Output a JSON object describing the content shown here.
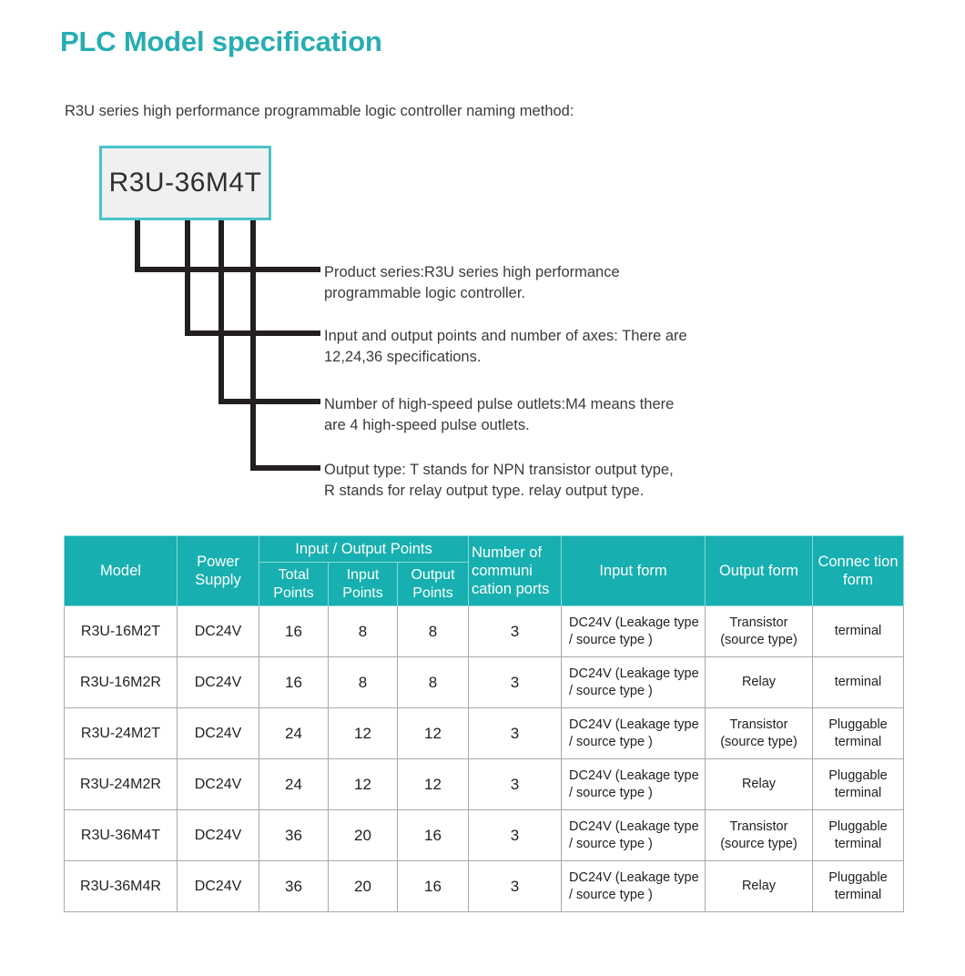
{
  "page": {
    "title": "PLC Model specification",
    "intro": "R3U series high performance programmable logic controller naming method:",
    "accent_color": "#27ADB2",
    "table_header_color": "#17AFAF",
    "box_border_color": "#4BC2C7",
    "box_fill_color": "#F0F0F0",
    "grid_line_color": "#A9A9A9"
  },
  "naming_diagram": {
    "model_box_value": "R3U-36M4T",
    "callouts": [
      {
        "id": "product-series",
        "line1": "Product series:R3U series high performance",
        "line2": "programmable logic controller."
      },
      {
        "id": "io-points-axes",
        "line1": "Input and output points and number of axes: There are",
        "line2": "12,24,36 specifications."
      },
      {
        "id": "high-speed-pulse-outlets",
        "line1": "Number of high-speed pulse outlets:M4 means there",
        "line2": "are 4 high-speed pulse outlets."
      },
      {
        "id": "output-type",
        "line1": "Output type: T stands for NPN transistor output type,",
        "line2": "R stands for relay output type. relay output type."
      }
    ]
  },
  "spec_table": {
    "headers": {
      "model": "Model",
      "power_supply": "Power Supply",
      "io_points_group": "Input / Output Points",
      "total_points": "Total Points",
      "input_points": "Input Points",
      "output_points": "Output Points",
      "comm_ports": "Number of communi cation ports",
      "input_form": "Input form",
      "output_form": "Output form",
      "connection_form": "Connec tion form"
    },
    "rows": [
      {
        "model": "R3U-16M2T",
        "power_supply": "DC24V",
        "total_points": "16",
        "input_points": "8",
        "output_points": "8",
        "comm_ports": "3",
        "input_form": "DC24V (Leakage type / source type )",
        "output_form": "Transistor (source type)",
        "connection_form": "terminal"
      },
      {
        "model": "R3U-16M2R",
        "power_supply": "DC24V",
        "total_points": "16",
        "input_points": "8",
        "output_points": "8",
        "comm_ports": "3",
        "input_form": "DC24V (Leakage type / source type )",
        "output_form": "Relay",
        "connection_form": "terminal"
      },
      {
        "model": "R3U-24M2T",
        "power_supply": "DC24V",
        "total_points": "24",
        "input_points": "12",
        "output_points": "12",
        "comm_ports": "3",
        "input_form": "DC24V (Leakage type / source type )",
        "output_form": "Transistor (source type)",
        "connection_form": "Pluggable terminal"
      },
      {
        "model": "R3U-24M2R",
        "power_supply": "DC24V",
        "total_points": "24",
        "input_points": "12",
        "output_points": "12",
        "comm_ports": "3",
        "input_form": "DC24V (Leakage type / source type )",
        "output_form": "Relay",
        "connection_form": "Pluggable terminal"
      },
      {
        "model": "R3U-36M4T",
        "power_supply": "DC24V",
        "total_points": "36",
        "input_points": "20",
        "output_points": "16",
        "comm_ports": "3",
        "input_form": "DC24V (Leakage type / source type )",
        "output_form": "Transistor (source type)",
        "connection_form": "Pluggable terminal"
      },
      {
        "model": "R3U-36M4R",
        "power_supply": "DC24V",
        "total_points": "36",
        "input_points": "20",
        "output_points": "16",
        "comm_ports": "3",
        "input_form": "DC24V (Leakage type / source type )",
        "output_form": "Relay",
        "connection_form": "Pluggable terminal"
      }
    ]
  }
}
